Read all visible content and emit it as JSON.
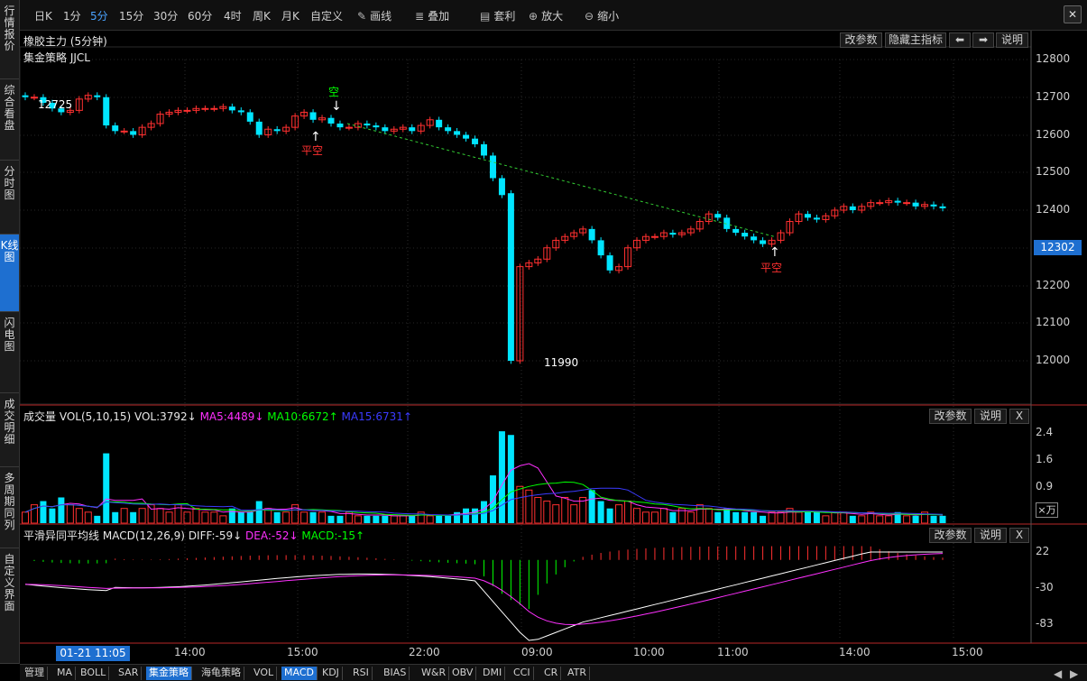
{
  "sidebar": {
    "tabs": [
      {
        "label": "行情报价",
        "active": false
      },
      {
        "label": "综合看盘",
        "active": false
      },
      {
        "label": "分时图",
        "active": false
      },
      {
        "label": "K线图",
        "active": true
      },
      {
        "label": "闪电图",
        "active": false
      },
      {
        "label": "成交明细",
        "active": false
      },
      {
        "label": "多周期同列",
        "active": false
      },
      {
        "label": "自定义界面",
        "active": false
      }
    ]
  },
  "toolbar": {
    "periods": [
      "日K",
      "1分",
      "5分",
      "15分",
      "30分",
      "60分",
      "4时",
      "周K",
      "月K",
      "自定义"
    ],
    "active_period": "5分",
    "tools": [
      {
        "label": "画线",
        "icon": "pen-icon"
      },
      {
        "label": "叠加",
        "icon": "stack-icon"
      },
      {
        "label": "套利",
        "icon": "arbitrage-icon"
      },
      {
        "label": "放大",
        "icon": "zoom-in-icon"
      },
      {
        "label": "缩小",
        "icon": "zoom-out-icon"
      }
    ]
  },
  "main": {
    "title": "橡胶主力 (5分钟)",
    "strategy": "集金策略 JJCL",
    "buttons": {
      "params": "改参数",
      "hide": "隐藏主指标",
      "left": "⬅",
      "right": "➡",
      "help": "说明"
    },
    "price_labels": [
      "12800",
      "12700",
      "12600",
      "12500",
      "12400",
      "12300",
      "12200",
      "12100",
      "12000"
    ],
    "current_price": "12302",
    "high_label": "12725",
    "low_label": "11990",
    "signals": [
      {
        "text": "空"
      },
      {
        "text": "平空"
      },
      {
        "text": "平空"
      }
    ]
  },
  "volume": {
    "title": "成交量",
    "params": "VOL(5,10,15)",
    "vol": "VOL:3792↓",
    "ma5": "MA5:4489↓",
    "ma10": "MA10:6672↑",
    "ma15": "MA15:6731↑",
    "y_labels": [
      "2.4",
      "1.6",
      "0.9"
    ],
    "unit": "×万",
    "buttons": {
      "params": "改参数",
      "help": "说明",
      "close": "X"
    }
  },
  "macd": {
    "title": "平滑异同平均线",
    "params": "MACD(12,26,9)",
    "diff": "DIFF:-59↓",
    "dea": "DEA:-52↓",
    "macd": "MACD:-15↑",
    "y_labels": [
      "22",
      "-30",
      "-83"
    ],
    "buttons": {
      "params": "改参数",
      "help": "说明",
      "close": "X"
    }
  },
  "xaxis": {
    "labels": [
      "14:00",
      "15:00",
      "22:00",
      "09:00",
      "10:00",
      "11:00",
      "14:00",
      "15:00"
    ],
    "cursor_label": "01-21 11:05"
  },
  "bottom_tabs": [
    "管理",
    "MA",
    "BOLL",
    "SAR",
    "集金策略",
    "海龟策略",
    "VOL",
    "MACD",
    "KDJ",
    "RSI",
    "BIAS",
    "W&R",
    "OBV",
    "DMI",
    "CCI",
    "CR",
    "ATR"
  ],
  "bottom_active": [
    "集金策略",
    "MACD"
  ],
  "colors": {
    "up": "#ff3030",
    "down": "#00e5ff",
    "bg": "#000000",
    "grid": "#2a2a2a",
    "ma5": "#ff30ff",
    "ma10": "#00ff00",
    "ma15": "#3b3bff",
    "diff": "#ffffff",
    "dea": "#ff30ff",
    "accent": "#1e6fd0"
  }
}
